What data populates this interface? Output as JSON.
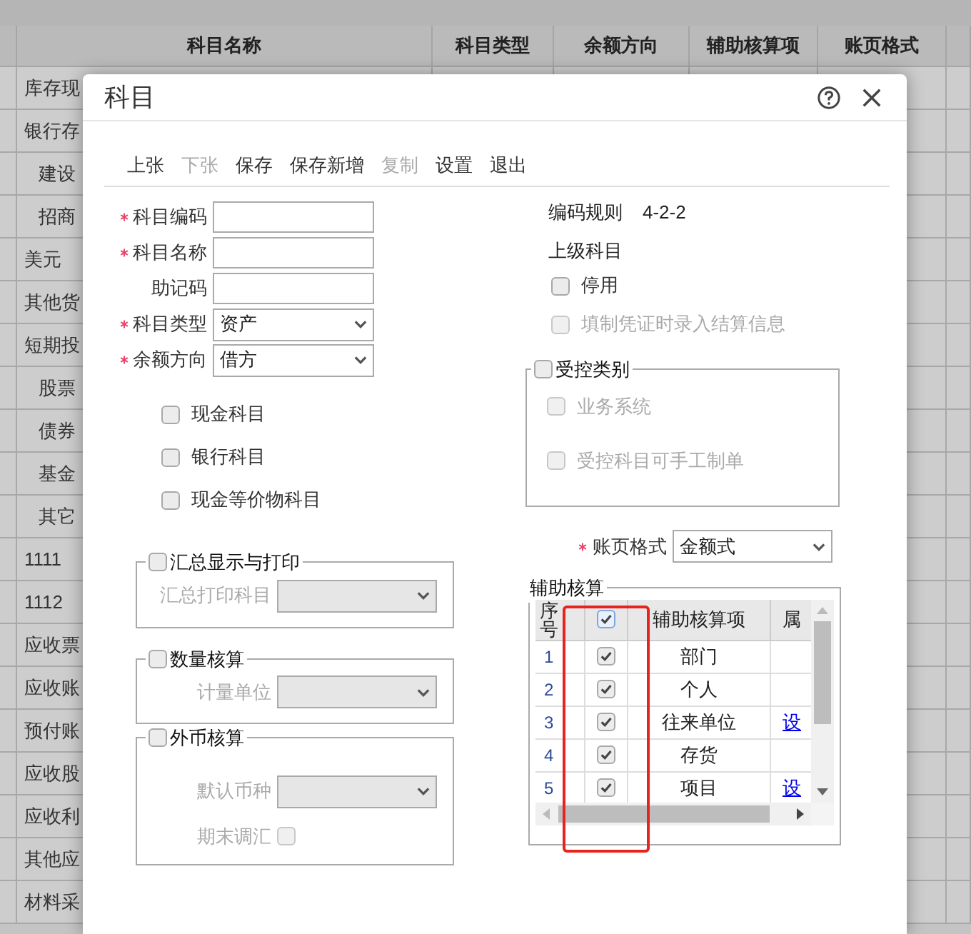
{
  "background_table": {
    "columns": [
      "科目名称",
      "科目类型",
      "余额方向",
      "辅助核算项",
      "账页格式"
    ],
    "rows": [
      {
        "name": "库存现"
      },
      {
        "name": "银行存",
        "children": [
          {
            "name": "建设"
          },
          {
            "name": "招商"
          }
        ]
      },
      {
        "name": "美元"
      },
      {
        "name": "其他货"
      },
      {
        "name": "短期投",
        "children": [
          {
            "name": "股票"
          },
          {
            "name": "债券"
          },
          {
            "name": "基金"
          },
          {
            "name": "其它"
          }
        ]
      },
      {
        "name": "1111"
      },
      {
        "name": "1112"
      },
      {
        "name": "应收票"
      },
      {
        "name": "应收账"
      },
      {
        "name": "预付账"
      },
      {
        "name": "应收股"
      },
      {
        "name": "应收利"
      },
      {
        "name": "其他应"
      },
      {
        "name": "材料采"
      }
    ]
  },
  "dialog": {
    "title": "科目",
    "toolbar": [
      {
        "label": "上张",
        "disabled": false
      },
      {
        "label": "下张",
        "disabled": true
      },
      {
        "label": "保存",
        "disabled": false
      },
      {
        "label": "保存新增",
        "disabled": false
      },
      {
        "label": "复制",
        "disabled": true
      },
      {
        "label": "设置",
        "disabled": false
      },
      {
        "label": "退出",
        "disabled": false
      }
    ],
    "fields": [
      {
        "kind": "text",
        "label": "科目编码",
        "required": true
      },
      {
        "kind": "text",
        "label": "科目名称",
        "required": true
      },
      {
        "kind": "text",
        "label": "助记码",
        "required": false
      },
      {
        "kind": "select",
        "label": "科目类型",
        "required": true,
        "value": "资产"
      },
      {
        "kind": "select",
        "label": "余额方向",
        "required": true,
        "value": "借方"
      }
    ],
    "account_options": [
      {
        "label": "现金科目",
        "checked": false
      },
      {
        "label": "银行科目",
        "checked": false
      },
      {
        "label": "现金等价物科目",
        "checked": false
      }
    ],
    "groups": [
      {
        "legend": "汇总显示与打印",
        "checked": false,
        "fields": [
          {
            "kind": "select",
            "label": "汇总打印科目",
            "disabled": true
          }
        ]
      },
      {
        "legend": "数量核算",
        "checked": false,
        "fields": [
          {
            "kind": "select",
            "label": "计量单位",
            "disabled": true
          }
        ]
      },
      {
        "legend": "外币核算",
        "checked": false,
        "fields": [
          {
            "kind": "select",
            "label": "默认币种",
            "disabled": true
          },
          {
            "kind": "checkbox",
            "label": "期末调汇",
            "disabled": true,
            "checked": false
          }
        ]
      }
    ],
    "coding_rule": {
      "label": "编码规则",
      "value": "4-2-2"
    },
    "parent_account": {
      "label": "上级科目"
    },
    "options": [
      {
        "label": "停用",
        "checked": false,
        "disabled": false
      },
      {
        "label": "填制凭证时录入结算信息",
        "checked": false,
        "disabled": true
      }
    ],
    "controlled": {
      "legend": "受控类别",
      "checked": false,
      "options": [
        {
          "label": "业务系统",
          "checked": false,
          "disabled": true
        },
        {
          "label": "受控科目可手工制单",
          "checked": false,
          "disabled": true
        }
      ]
    },
    "ledger_format": {
      "label": "账页格式",
      "required": true,
      "value": "金额式"
    },
    "auxiliary": {
      "legend": "辅助核算",
      "columns": [
        "序号",
        "辅助核算项",
        "属"
      ],
      "all_checked": true,
      "rows": [
        {
          "no": "1",
          "checked": true,
          "item": "部门"
        },
        {
          "no": "2",
          "checked": true,
          "item": "个人"
        },
        {
          "no": "3",
          "checked": true,
          "item": "往来单位",
          "link": "设"
        },
        {
          "no": "4",
          "checked": true,
          "item": "存货"
        },
        {
          "no": "5",
          "checked": true,
          "item": "项目",
          "link": "设"
        }
      ]
    }
  }
}
